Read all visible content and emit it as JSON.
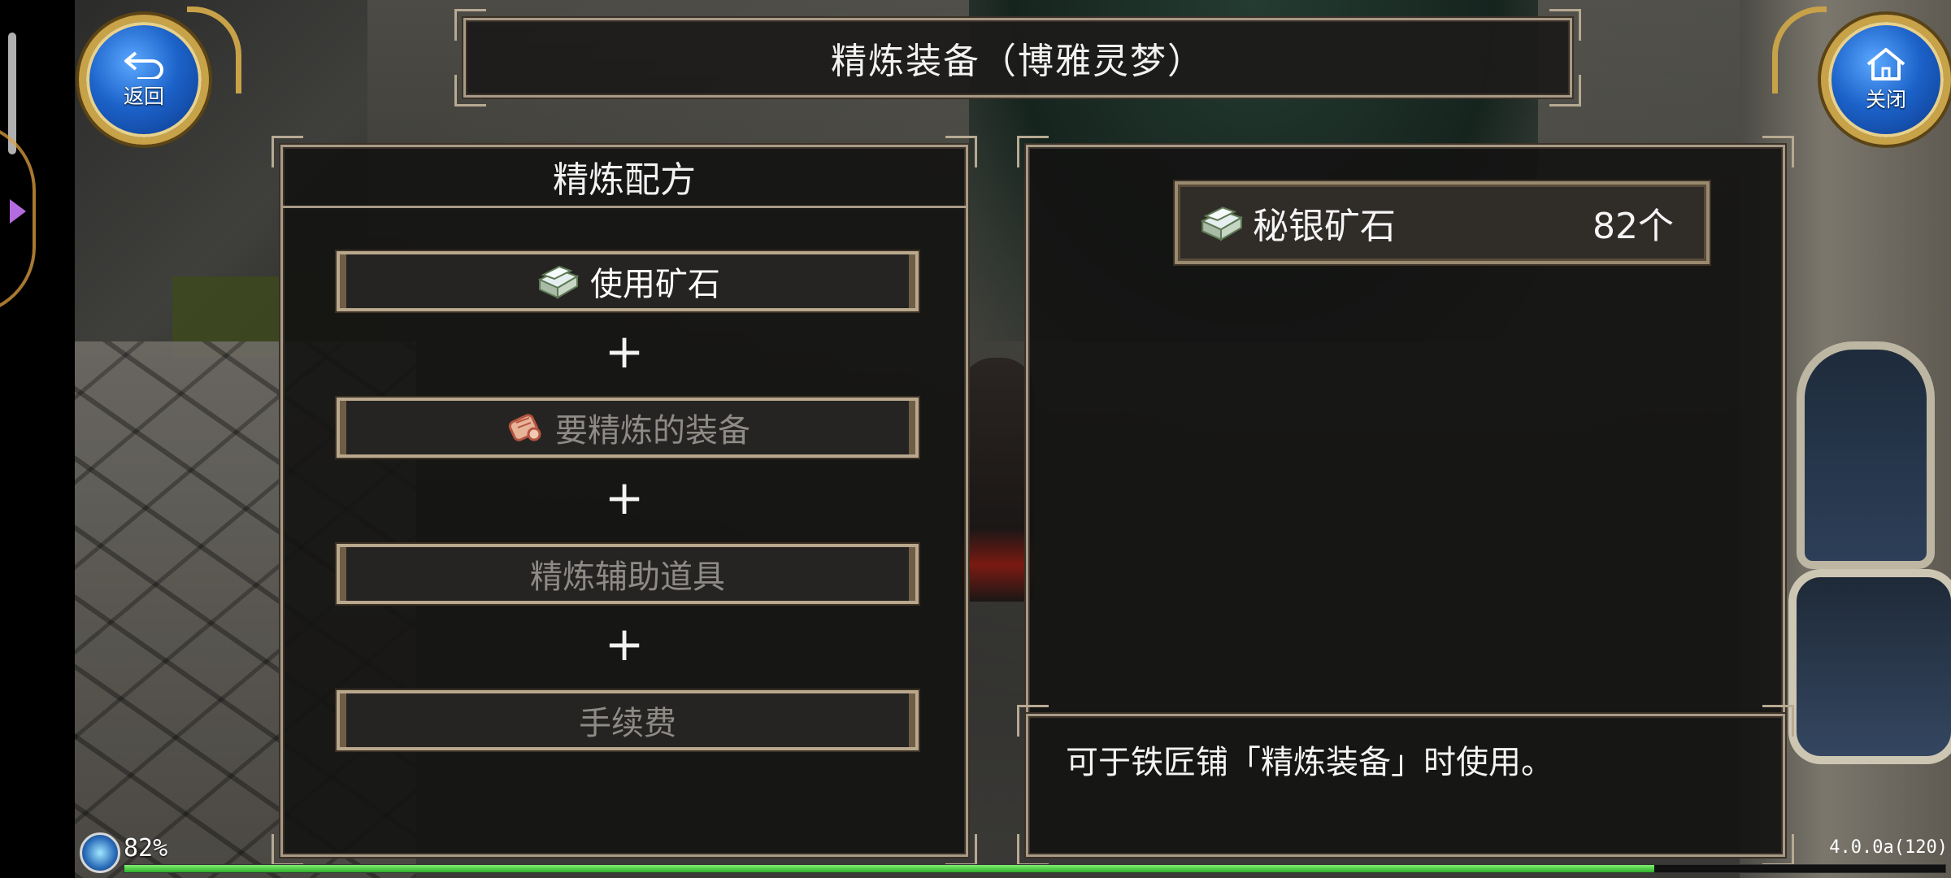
{
  "header": {
    "title": "精炼装备（博雅灵梦）",
    "back_label": "返回",
    "close_label": "关闭"
  },
  "recipe": {
    "title": "精炼配方",
    "slots": [
      {
        "label": "使用矿石",
        "icon": "ore-icon",
        "state": "filled"
      },
      {
        "label": "要精炼的装备",
        "icon": "scroll-icon",
        "state": "empty"
      },
      {
        "label": "精炼辅助道具",
        "state": "empty"
      },
      {
        "label": "手续费",
        "state": "empty"
      }
    ],
    "plus_symbol": "+"
  },
  "inventory": {
    "items": [
      {
        "name": "秘银矿石",
        "count": "82个",
        "icon": "ore-icon"
      }
    ]
  },
  "description": {
    "text": "可于铁匠铺「精炼装备」时使用。"
  },
  "status": {
    "battery": "82%",
    "progress": 0.84,
    "version": "4.0.0a(120)"
  },
  "colors": {
    "button_blue": "#1c62c9",
    "gold_trim": "#c8a248",
    "panel_bg": "#141312",
    "frame_border": "#a89a86",
    "progress_green": "#2fae2b"
  }
}
